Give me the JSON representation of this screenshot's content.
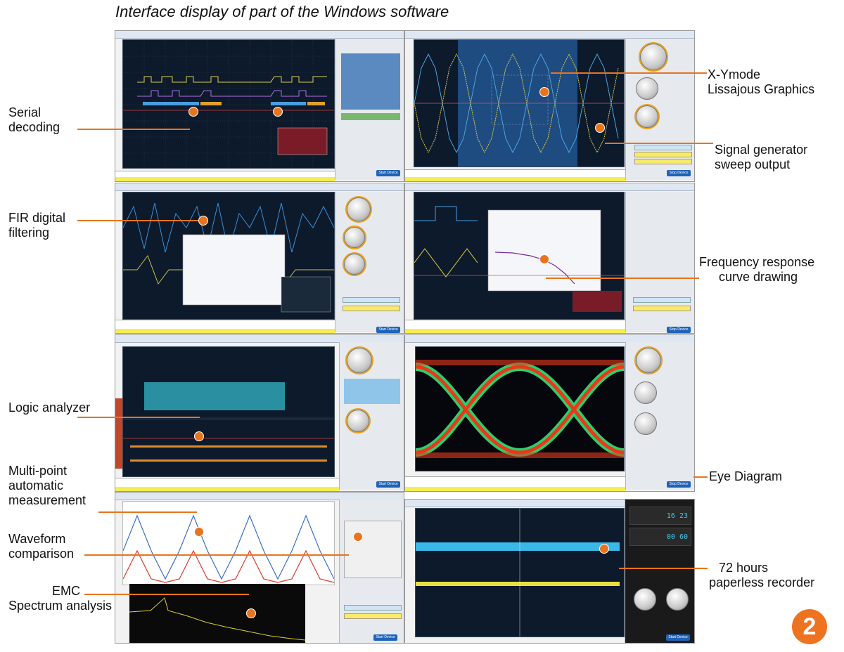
{
  "header": {
    "title": "Interface display of part of the Windows software"
  },
  "labels": {
    "serial_decoding": [
      "Serial",
      "decoding"
    ],
    "xy_mode": [
      "X-Ymode",
      "Lissajous Graphics"
    ],
    "signal_generator": [
      "Signal generator",
      "sweep output"
    ],
    "fir_filtering": [
      "FIR digital",
      "filtering"
    ],
    "frequency_response": [
      "Frequency response",
      "curve drawing"
    ],
    "logic_analyzer": [
      "Logic analyzer"
    ],
    "eye_diagram": [
      "Eye  Diagram"
    ],
    "multi_point": [
      "Multi-point",
      "automatic",
      "measurement"
    ],
    "waveform_comparison": [
      "Waveform",
      "comparison"
    ],
    "emc": [
      "EMC",
      "Spectrum analysis"
    ],
    "recorder": [
      "72 hours",
      "paperless recorder"
    ]
  },
  "ui": {
    "start_device": "Start Device",
    "stop_device": "Stop Device",
    "recorder_digits_1": "16 23",
    "recorder_digits_2": "00 60"
  },
  "badge": {
    "number": "2"
  },
  "colors": {
    "accent": "#e8741e",
    "scope_bg": "#0d1a2b",
    "badge": "#ee7320"
  },
  "icons": [
    "knob-icon",
    "leader-dot-icon"
  ]
}
